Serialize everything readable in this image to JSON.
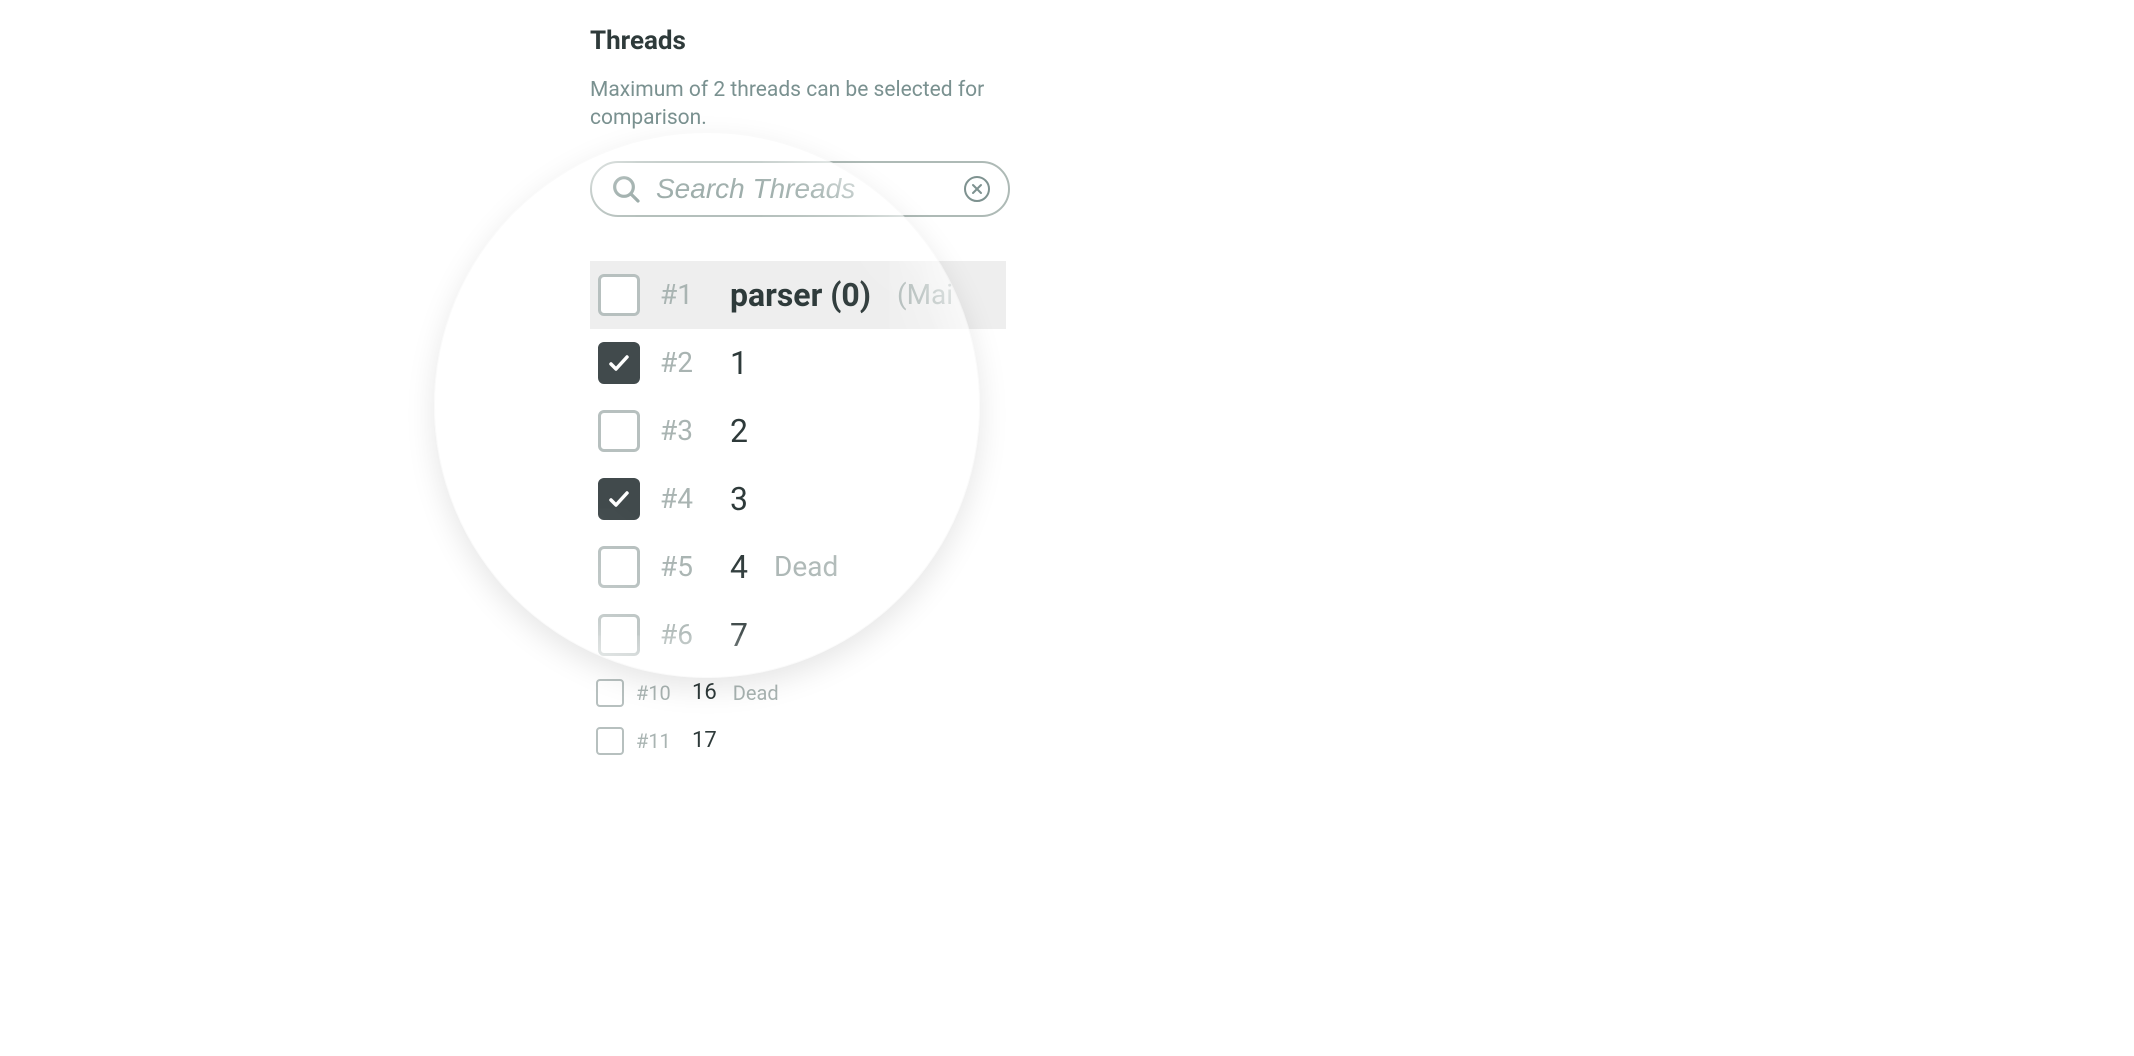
{
  "header": {
    "title": "Threads",
    "subtitle": "Maximum of 2 threads can be selected for comparison."
  },
  "search": {
    "placeholder": "Search Threads",
    "value": ""
  },
  "threads": [
    {
      "index": "#1",
      "name": "parser (0)",
      "status": "(Mai",
      "checked": false,
      "bold": true,
      "size": "big",
      "highlight": true
    },
    {
      "index": "#2",
      "name": "1",
      "status": "",
      "checked": true,
      "bold": false,
      "size": "big",
      "highlight": false
    },
    {
      "index": "#3",
      "name": "2",
      "status": "",
      "checked": false,
      "bold": false,
      "size": "big",
      "highlight": false
    },
    {
      "index": "#4",
      "name": "3",
      "status": "",
      "checked": true,
      "bold": false,
      "size": "big",
      "highlight": false
    },
    {
      "index": "#5",
      "name": "4",
      "status": "Dead",
      "checked": false,
      "bold": false,
      "size": "big",
      "highlight": false
    },
    {
      "index": "#6",
      "name": "7",
      "status": "",
      "checked": false,
      "bold": false,
      "size": "big",
      "highlight": false
    },
    {
      "index": "#10",
      "name": "16",
      "status": "Dead",
      "checked": false,
      "bold": false,
      "size": "small",
      "highlight": false
    },
    {
      "index": "#11",
      "name": "17",
      "status": "",
      "checked": false,
      "bold": false,
      "size": "small",
      "highlight": false
    }
  ]
}
